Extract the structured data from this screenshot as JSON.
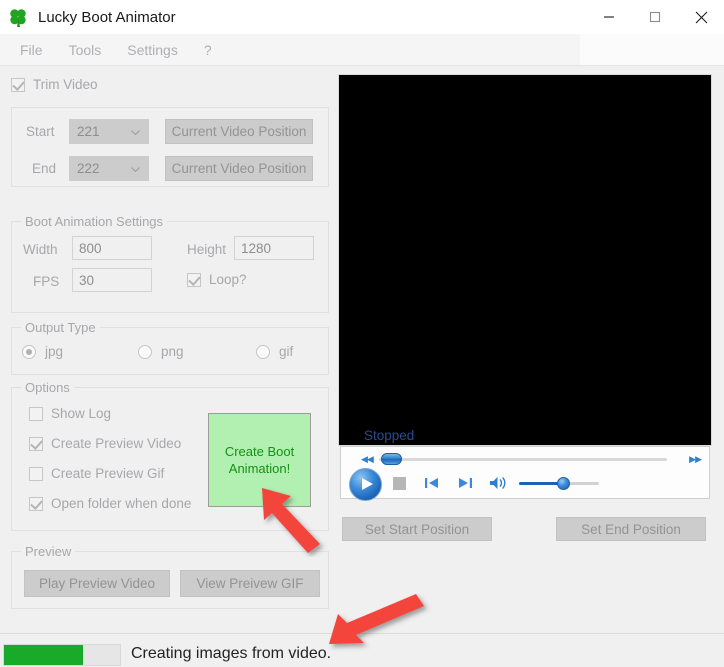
{
  "window": {
    "title": "Lucky Boot Animator",
    "icon": "clover-icon",
    "minimize_label": "–",
    "maximize_label": "□",
    "close_label": "✕"
  },
  "menu": {
    "items": [
      {
        "label": "File",
        "name": "menu-file"
      },
      {
        "label": "Tools",
        "name": "menu-tools"
      },
      {
        "label": "Settings",
        "name": "menu-settings"
      },
      {
        "label": "?",
        "name": "menu-help"
      }
    ]
  },
  "trim": {
    "checkbox_label": "Trim Video",
    "checked": true,
    "start_label": "Start",
    "start_value": "221",
    "end_label": "End",
    "end_value": "222",
    "current_position_label": "Current Video Position"
  },
  "boot_settings": {
    "group_title": "Boot Animation Settings",
    "width_label": "Width",
    "width_value": "800",
    "height_label": "Height",
    "height_value": "1280",
    "fps_label": "FPS",
    "fps_value": "30",
    "loop_label": "Loop?",
    "loop_checked": true
  },
  "output_type": {
    "group_title": "Output Type",
    "options": [
      {
        "label": "jpg",
        "selected": true
      },
      {
        "label": "png",
        "selected": false
      },
      {
        "label": "gif",
        "selected": false
      }
    ]
  },
  "options": {
    "group_title": "Options",
    "items": [
      {
        "label": "Show Log",
        "checked": false
      },
      {
        "label": "Create Preview Video",
        "checked": true
      },
      {
        "label": "Create Preview Gif",
        "checked": false
      },
      {
        "label": "Open folder when done",
        "checked": true
      }
    ],
    "create_button_label": "Create Boot Animation!",
    "create_button_color": "#b2f0b2",
    "create_button_text_color": "#149114"
  },
  "preview": {
    "group_title": "Preview",
    "play_label": "Play Preview Video",
    "view_gif_label": "View Preivew GIF"
  },
  "player": {
    "status": "Stopped",
    "status_color": "#2a4b8d",
    "seek_percent": 2,
    "volume_percent": 55,
    "set_start_label": "Set Start Position",
    "set_end_label": "Set End Position"
  },
  "status_bar": {
    "message": "Creating images from video.",
    "progress_percent": 68,
    "progress_color": "#1aaa2a"
  },
  "annotations": {
    "arrow_color": "#f4443c",
    "arrow_1_target": "create-boot-animation-button",
    "arrow_2_target": "status-bar-message"
  }
}
